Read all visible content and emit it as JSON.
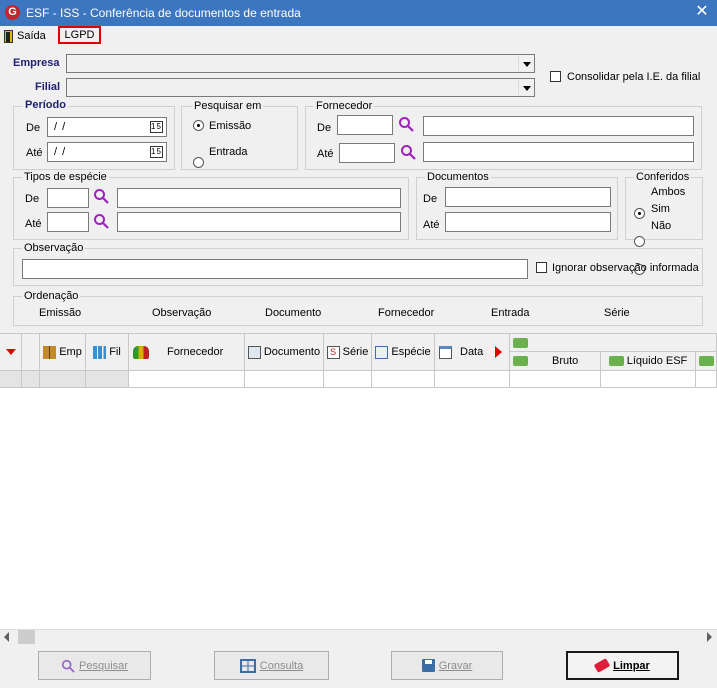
{
  "window": {
    "title": "ESF - ISS - Conferência de documentos de entrada",
    "app_icon_letter": "G"
  },
  "menu": {
    "exit_label": "Saída",
    "lgpd_label": "LGPD"
  },
  "empresa_label": "Empresa",
  "filial_label": "Filial",
  "consolidar_label": "Consolidar pela I.E. da filial",
  "periodo": {
    "title": "Período",
    "de_label": "De",
    "ate_label": "Até",
    "de_value": "/ /",
    "ate_value": "/ /",
    "calendar_glyph": "15"
  },
  "pesquisar_em": {
    "title": "Pesquisar em",
    "options": [
      "Emissão",
      "Entrada"
    ],
    "selected": "Emissão"
  },
  "fornecedor": {
    "title": "Fornecedor",
    "de_label": "De",
    "ate_label": "Até"
  },
  "tipos_especie": {
    "title": "Tipos de espécie",
    "de_label": "De",
    "ate_label": "Até"
  },
  "documentos": {
    "title": "Documentos",
    "de_label": "De",
    "ate_label": "Até"
  },
  "conferidos": {
    "title": "Conferidos",
    "options": [
      "Ambos",
      "Sim",
      "Não"
    ],
    "selected": "Ambos"
  },
  "observacao": {
    "title": "Observação",
    "ignore_label": "Ignorar observação informada"
  },
  "ordenacao": {
    "title": "Ordenação",
    "options": [
      "Emissão",
      "Observação",
      "Documento",
      "Fornecedor",
      "Entrada",
      "Série"
    ],
    "selected": "Emissão"
  },
  "grid": {
    "columns": [
      "Emp",
      "Fil",
      "Fornecedor",
      "Documento",
      "Série",
      "Espécie",
      "Data"
    ],
    "sub_columns": [
      "Bruto",
      "Líquido ESF"
    ]
  },
  "buttons": {
    "pesquisar": "Pesquisar",
    "consulta": "Consulta",
    "gravar": "Gravar",
    "limpar": "Limpar"
  },
  "colors": {
    "titlebar": "#3c76be",
    "highlight_border": "#e00000",
    "search_icon": "#a020c0"
  }
}
